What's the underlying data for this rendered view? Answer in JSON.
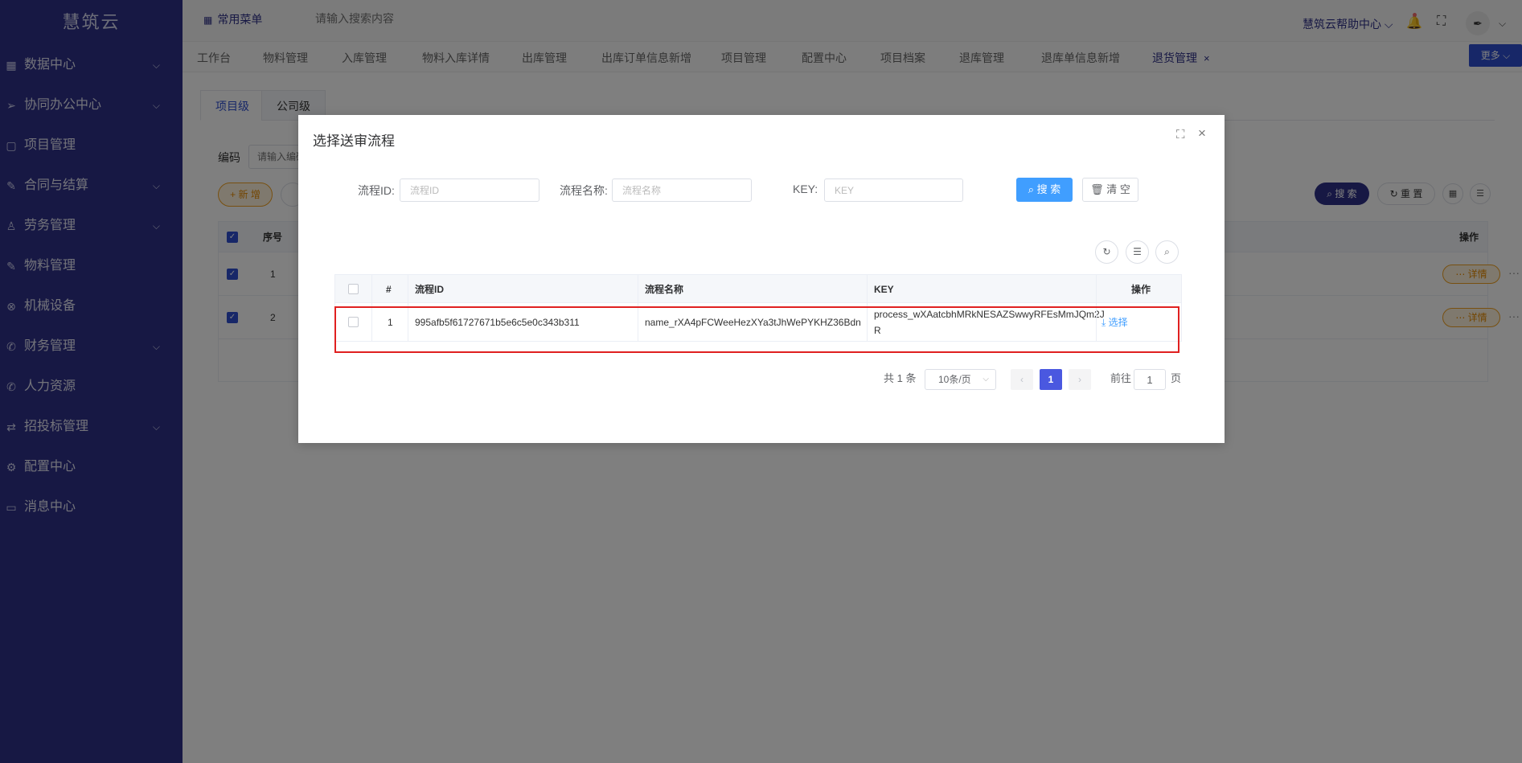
{
  "sidebar": {
    "logo": "慧筑云",
    "items": [
      {
        "label": "数据中心",
        "icon": "grid-icon",
        "glyph": "▦",
        "expandable": true
      },
      {
        "label": "协同办公中心",
        "icon": "send-icon",
        "glyph": "➢",
        "expandable": true
      },
      {
        "label": "项目管理",
        "icon": "book-icon",
        "glyph": "▢",
        "expandable": false
      },
      {
        "label": "合同与结算",
        "icon": "edit-icon",
        "glyph": "✎",
        "expandable": true
      },
      {
        "label": "劳务管理",
        "icon": "user-icon",
        "glyph": "♙",
        "expandable": true
      },
      {
        "label": "物料管理",
        "icon": "edit-icon",
        "glyph": "✎",
        "expandable": false
      },
      {
        "label": "机械设备",
        "icon": "circle-x-icon",
        "glyph": "⊗",
        "expandable": false
      },
      {
        "label": "财务管理",
        "icon": "phone-icon",
        "glyph": "✆",
        "expandable": true
      },
      {
        "label": "人力资源",
        "icon": "phone-icon",
        "glyph": "✆",
        "expandable": false
      },
      {
        "label": "招投标管理",
        "icon": "swap-icon",
        "glyph": "⇄",
        "expandable": true
      },
      {
        "label": "配置中心",
        "icon": "gear-icon",
        "glyph": "⚙",
        "expandable": false
      },
      {
        "label": "消息中心",
        "icon": "chat-icon",
        "glyph": "▭",
        "expandable": false
      }
    ]
  },
  "topbar": {
    "menu_label": "常用菜单",
    "search_placeholder": "请输入搜索内容",
    "help_label": "慧筑云帮助中心 ⌵"
  },
  "tabs": {
    "items": [
      "工作台",
      "物料管理",
      "入库管理",
      "物料入库详情",
      "出库管理",
      "出库订单信息新增",
      "项目管理",
      "配置中心",
      "项目档案",
      "退库管理",
      "退库单信息新增",
      "退货管理"
    ],
    "active": "退货管理",
    "close": "×",
    "more": "更多 ⌵"
  },
  "content": {
    "subtabs": [
      "项目级",
      "公司级"
    ],
    "code_label": "编码",
    "code_placeholder": "请输入编码",
    "add_label": "+ 新 增",
    "search_label": "⌕ 搜 索",
    "reset_label": "↻ 重 置",
    "table": {
      "check_header": "✓",
      "index_header": "序号",
      "action_header": "操作",
      "rows": [
        {
          "index": "1",
          "detail": "⋯ 详情",
          "more": "···"
        },
        {
          "index": "2",
          "detail": "⋯ 详情",
          "more": "···"
        }
      ]
    }
  },
  "dialog": {
    "title": "选择送审流程",
    "filters": {
      "id_label": "流程ID:",
      "id_placeholder": "流程ID",
      "name_label": "流程名称:",
      "name_placeholder": "流程名称",
      "key_label": "KEY:",
      "key_placeholder": "KEY"
    },
    "search_btn": "⌕ 搜 索",
    "clear_btn": "🗑 清 空",
    "table": {
      "headers": {
        "index": "#",
        "id": "流程ID",
        "name": "流程名称",
        "key": "KEY",
        "action": "操作"
      },
      "rows": [
        {
          "index": "1",
          "id": "995afb5f61727671b5e6c5e0c343b311",
          "name": "name_rXA4pFCWeeHezXYa3tJhWePYKHZ36Bdn",
          "key_line1": "process_wXAatcbhMRkNESAZSwwyRFEsMmJQm2J",
          "key_line2": "R",
          "action": "⤓ 选择"
        }
      ]
    },
    "pagination": {
      "total": "共 1 条",
      "page_size": "10条/页",
      "current": "1",
      "prev": "‹",
      "next": "›",
      "goto_label": "前往",
      "goto_value": "1",
      "page_suffix": "页"
    }
  },
  "colors": {
    "sidebar": "#2f3189",
    "primary": "#409eff",
    "accent": "#4a58e0",
    "highlight": "#e02020"
  }
}
